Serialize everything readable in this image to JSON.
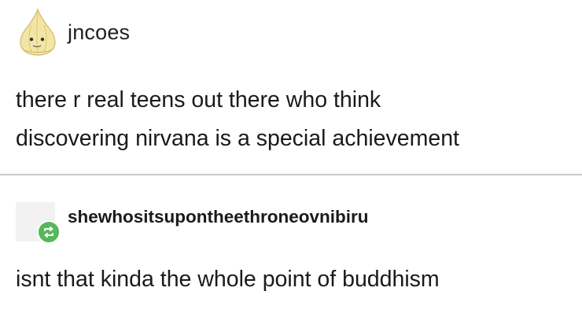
{
  "post": {
    "username": "jncoes",
    "avatar_icon": "garlic-avatar-icon",
    "body_lines": [
      "there r real teens out there who think",
      "discovering nirvana is a special achievement"
    ]
  },
  "reblog": {
    "username": "shewhositsupontheethroneovnibiru",
    "badge_icon": "reblog-icon",
    "badge_color": "#56b85a",
    "body": "isnt that kinda the whole point of buddhism"
  }
}
